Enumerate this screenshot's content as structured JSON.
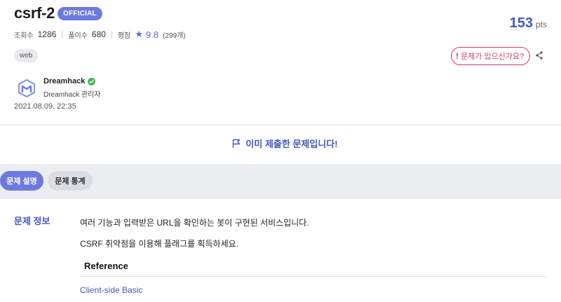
{
  "header": {
    "title": "csrf-2",
    "badge": "OFFICIAL",
    "stats": {
      "views_label": "조회수",
      "views": "1286",
      "solves_label": "풀이수",
      "solves": "680",
      "rating_label": "평점",
      "rating": "9.8",
      "rating_count": "(299개)"
    },
    "points": {
      "value": "153",
      "unit": "pts"
    },
    "tag": "web",
    "report_label": "문제가 있으신가요?",
    "report_icon": "!",
    "author": {
      "name": "Dreamhack",
      "role": "Dreamhack 관리자"
    },
    "date": "2021.08.09. 22:35"
  },
  "notice": {
    "text": "이미 제출한 문제입니다!"
  },
  "tabs": [
    {
      "label": "문제 설명",
      "active": true
    },
    {
      "label": "문제 통계",
      "active": false
    }
  ],
  "info": {
    "section_title": "문제 정보",
    "paragraphs": [
      "여러 기능과 입력받은 URL을 확인하는 봇이 구현된 서비스입니다.",
      "CSRF 취약점을 이용해 플래그를 획득하세요."
    ],
    "reference_heading": "Reference",
    "reference_link": "Client-side Basic"
  },
  "colors": {
    "accent": "#4458c0",
    "badge": "#6c7ae0",
    "report": "#d23a6a",
    "tabbar": "#ecedf1"
  }
}
